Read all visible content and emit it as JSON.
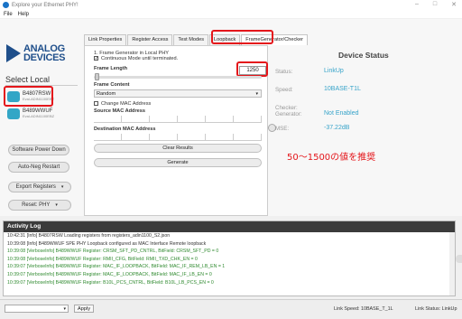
{
  "window": {
    "title": "Explore your Ethernet PHY!",
    "controls": [
      "–",
      "□",
      "✕"
    ]
  },
  "menu": {
    "file": "File",
    "help": "Help"
  },
  "brand": {
    "logo_line1": "ANALOG",
    "logo_line2": "DEVICES"
  },
  "sidebar": {
    "heading": "Select Local",
    "devices": [
      {
        "name": "B4807RSW",
        "sub": "Eval-ADIN1100EBZ"
      },
      {
        "name": "B489WWUF",
        "sub": "Eval-ADIN1100EBZ"
      }
    ],
    "buttons": {
      "power_down": "Software Power Down",
      "auto_neg": "Auto-Neg Restart",
      "export": "Export Registers",
      "reset": "Reset: PHY"
    }
  },
  "tabs": [
    {
      "label": "Link Properties"
    },
    {
      "label": "Register Access"
    },
    {
      "label": "Test Modes"
    },
    {
      "label": "Loopback"
    },
    {
      "label": "FrameGenerator/Checker"
    }
  ],
  "framegen": {
    "desc": "1. Frame Generator in Local PHY",
    "continuous": "Continuous Mode until terminated.",
    "frame_length_label": "Frame Length",
    "frame_length_value": "1250",
    "frame_content_label": "Frame Content",
    "frame_content_value": "Random",
    "change_mac_label": "Change MAC Address",
    "source_mac_label": "Source MAC Address",
    "dest_mac_label": "Destination MAC Address",
    "clear_results": "Clear Results",
    "generate": "Generate"
  },
  "status": {
    "title": "Device Status",
    "rows": [
      {
        "label": "Status:",
        "value": "LinkUp"
      },
      {
        "label": "Speed:",
        "value": "10BASE-T1L"
      },
      {
        "label": "Checker:",
        "value": ""
      },
      {
        "label": "Generator:",
        "value": "Not Enabled"
      },
      {
        "label": "MSE:",
        "value": "-37.22dB"
      }
    ]
  },
  "annotation": {
    "text": "50～1500の値を推奨"
  },
  "activity_log": {
    "title": "Activity Log",
    "lines": [
      {
        "text": "10:42:31 [Info] B4807RSW Loading registers from registers_adin1100_S2.json",
        "kind": "info"
      },
      {
        "text": "10:39:08 [Info] B489WWUF   SPE PHY Loopback configured as MAC Interface Remote loopback",
        "kind": "info"
      },
      {
        "text": "10:39:08 [VerboseInfo] B489WWUF Register: CRSM_SFT_PD_CNTRL, BitField: CRSM_SFT_PD = 0",
        "kind": "verbose"
      },
      {
        "text": "10:39:08 [VerboseInfo] B489WWUF Register: RMII_CFG, BitField: RMII_TXD_CHK_EN = 0",
        "kind": "verbose"
      },
      {
        "text": "10:39:07 [VerboseInfo] B489WWUF Register: MAC_IF_LOOPBACK, BitField: MAC_IF_REM_LB_EN = 1",
        "kind": "verbose"
      },
      {
        "text": "10:39:07 [VerboseInfo] B489WWUF Register: MAC_IF_LOOPBACK, BitField: MAC_IF_LB_EN = 0",
        "kind": "verbose"
      },
      {
        "text": "10:39:07 [VerboseInfo] B489WWUF Register: B10L_PCS_CNTRL, BitField: B10L_LB_PCS_EN = 0",
        "kind": "verbose"
      }
    ]
  },
  "footer": {
    "apply": "Apply",
    "speed": "Link Speed: 10BASE_T_1L",
    "link_status": "Link Status: LinkUp"
  }
}
